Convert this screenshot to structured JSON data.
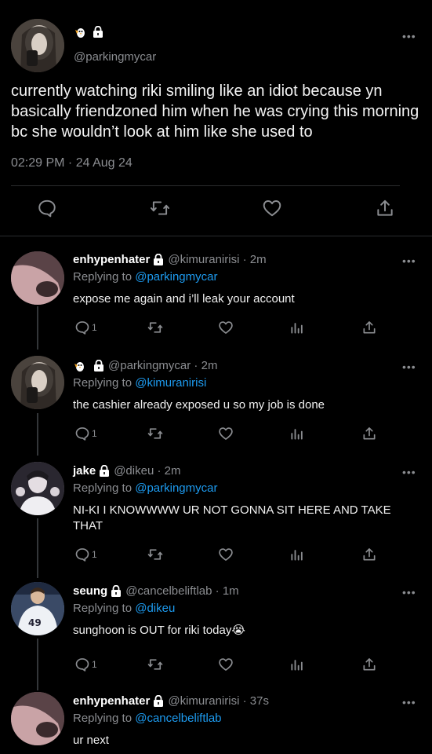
{
  "main_tweet": {
    "handle": "@parkingmycar",
    "text": "currently watching riki smiling like an idiot because yn basically friendzoned him when he was crying this morning bc she wouldn’t look at him like she used to",
    "timestamp": "02:29 PM · 24 Aug 24"
  },
  "replies": [
    {
      "name": "enhypenhater",
      "handle": "@kimuranirisi",
      "time": "2m",
      "replying_label": "Replying to ",
      "replying_to": "@parkingmycar",
      "text": "expose me again and i’ll leak your account",
      "reply_count": "1"
    },
    {
      "name": "",
      "handle": "@parkingmycar",
      "time": "2m",
      "replying_label": "Replying to ",
      "replying_to": "@kimuranirisi",
      "text": "the cashier already exposed u so my job is done",
      "reply_count": "1"
    },
    {
      "name": "jake",
      "handle": "@dikeu",
      "time": "2m",
      "replying_label": "Replying to ",
      "replying_to": "@parkingmycar",
      "text": "NI-KI I KNOWWWW UR NOT GONNA SIT HERE AND TAKE THAT",
      "reply_count": "1"
    },
    {
      "name": "seung",
      "handle": "@cancelbeliftlab",
      "time": "1m",
      "replying_label": "Replying to ",
      "replying_to": "@dikeu",
      "text": "sunghoon is OUT for riki today",
      "emoji": "😭",
      "reply_count": "1"
    },
    {
      "name": "enhypenhater",
      "handle": "@kimuranirisi",
      "time": "37s",
      "replying_label": "Replying to ",
      "replying_to": "@cancelbeliftlab",
      "text": "ur next"
    }
  ],
  "separator": " · ",
  "more_glyph": "•••",
  "colors": {
    "background": "#000000",
    "text_secondary": "#8b8d91",
    "link": "#1d9bf0",
    "divider": "#2a2c2e"
  },
  "icons": [
    "penguin-icon",
    "lock-icon",
    "reply-icon",
    "retweet-icon",
    "like-icon",
    "share-icon",
    "analytics-icon",
    "more-icon"
  ]
}
